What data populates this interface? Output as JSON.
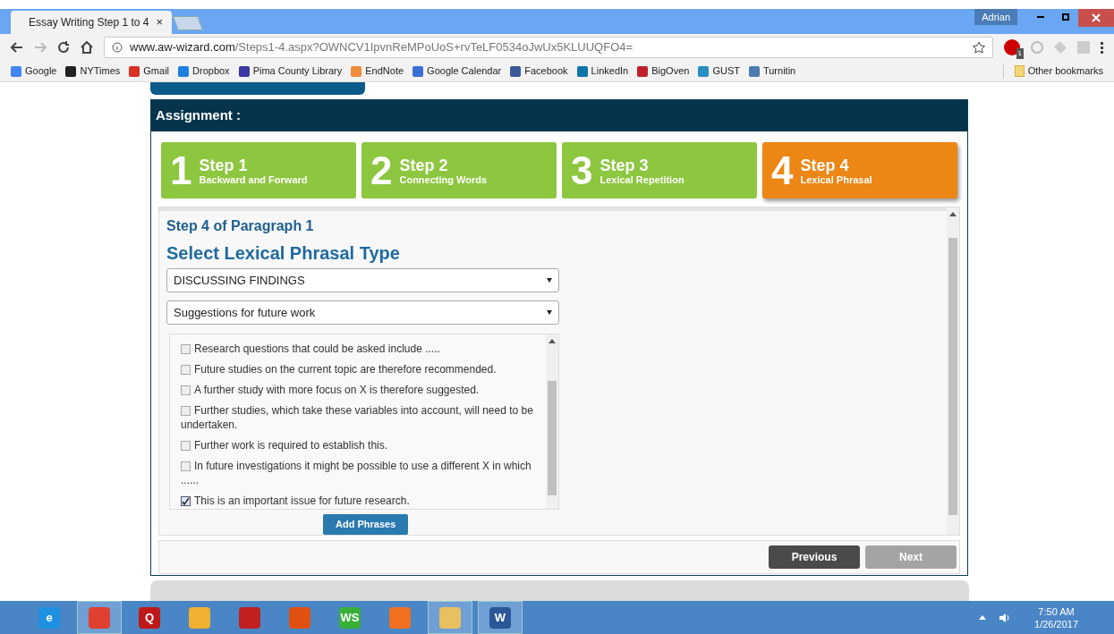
{
  "browser": {
    "tab_title": "Essay Writing Step 1 to 4",
    "tab_close": "×",
    "user": "Adrian",
    "url_host": "www.aw-wizard.com",
    "url_path": "/Steps1-4.aspx?OWNCV1IpvnReMPoUoS+rvTeLF0534oJwUx5KLUUQFO4=",
    "extension_badge": "1",
    "bookmarks": [
      {
        "label": "Google",
        "color": "#4285f4"
      },
      {
        "label": "NYTimes",
        "color": "#222222"
      },
      {
        "label": "Gmail",
        "color": "#d93025"
      },
      {
        "label": "Dropbox",
        "color": "#1f7fe0"
      },
      {
        "label": "Pima County Library",
        "color": "#3a3aa0"
      },
      {
        "label": "EndNote",
        "color": "#f08a3c"
      },
      {
        "label": "Google Calendar",
        "color": "#3b6fd4"
      },
      {
        "label": "Facebook",
        "color": "#3b5998"
      },
      {
        "label": "LinkedIn",
        "color": "#0e76a8"
      },
      {
        "label": "BigOven",
        "color": "#c0202a"
      },
      {
        "label": "GUST",
        "color": "#2a8fc0"
      },
      {
        "label": "Turnitin",
        "color": "#4a7ab0"
      }
    ],
    "other_bookmarks": "Other bookmarks"
  },
  "page": {
    "header": "Assignment :",
    "steps": [
      {
        "number": "1",
        "title": "Step 1",
        "subtitle": "Backward and Forward",
        "selected": false
      },
      {
        "number": "2",
        "title": "Step 2",
        "subtitle": "Connecting Words",
        "selected": false
      },
      {
        "number": "3",
        "title": "Step 3",
        "subtitle": "Lexical Repetition",
        "selected": false
      },
      {
        "number": "4",
        "title": "Step 4",
        "subtitle": "Lexical Phrasal",
        "selected": true
      }
    ],
    "subheading": "Step 4 of Paragraph 1",
    "heading": "Select Lexical Phrasal Type",
    "dropdowns": [
      "DISCUSSING FINDINGS",
      "Suggestions for future work"
    ],
    "phrases": [
      {
        "text": "Research questions that could be asked include .....",
        "checked": false
      },
      {
        "text": "Future studies on the current topic are therefore recommended.",
        "checked": false
      },
      {
        "text": "A further study with more focus on X is therefore suggested.",
        "checked": false
      },
      {
        "text": "Further studies, which take these variables into account, will need to be undertaken.",
        "checked": false
      },
      {
        "text": "Further work is required to establish this.",
        "checked": false
      },
      {
        "text": "In future investigations it might be possible to use a different X in which ......",
        "checked": false
      },
      {
        "text": "This is an important issue for future research.",
        "checked": true
      }
    ],
    "add_button": "Add Phrases",
    "nav_buttons": [
      {
        "label": "Previous",
        "disabled": false
      },
      {
        "label": "Next",
        "disabled": true
      }
    ]
  },
  "taskbar": {
    "apps": [
      {
        "label": "e",
        "color": "#1e90e0",
        "active": false
      },
      {
        "color": "#e04030",
        "active": true
      },
      {
        "label": "Q",
        "color": "#c01818",
        "active": false
      },
      {
        "color": "#f0b030",
        "active": false
      },
      {
        "color": "#c02020",
        "active": false
      },
      {
        "color": "#e05010",
        "active": false
      },
      {
        "label": "WS",
        "color": "#38b038",
        "active": false
      },
      {
        "color": "#f07020",
        "active": false
      },
      {
        "color": "#e8c060",
        "active": true
      },
      {
        "label": "W",
        "color": "#2b5797",
        "active": true
      }
    ],
    "time": "7:50 AM",
    "date": "1/26/2017"
  }
}
